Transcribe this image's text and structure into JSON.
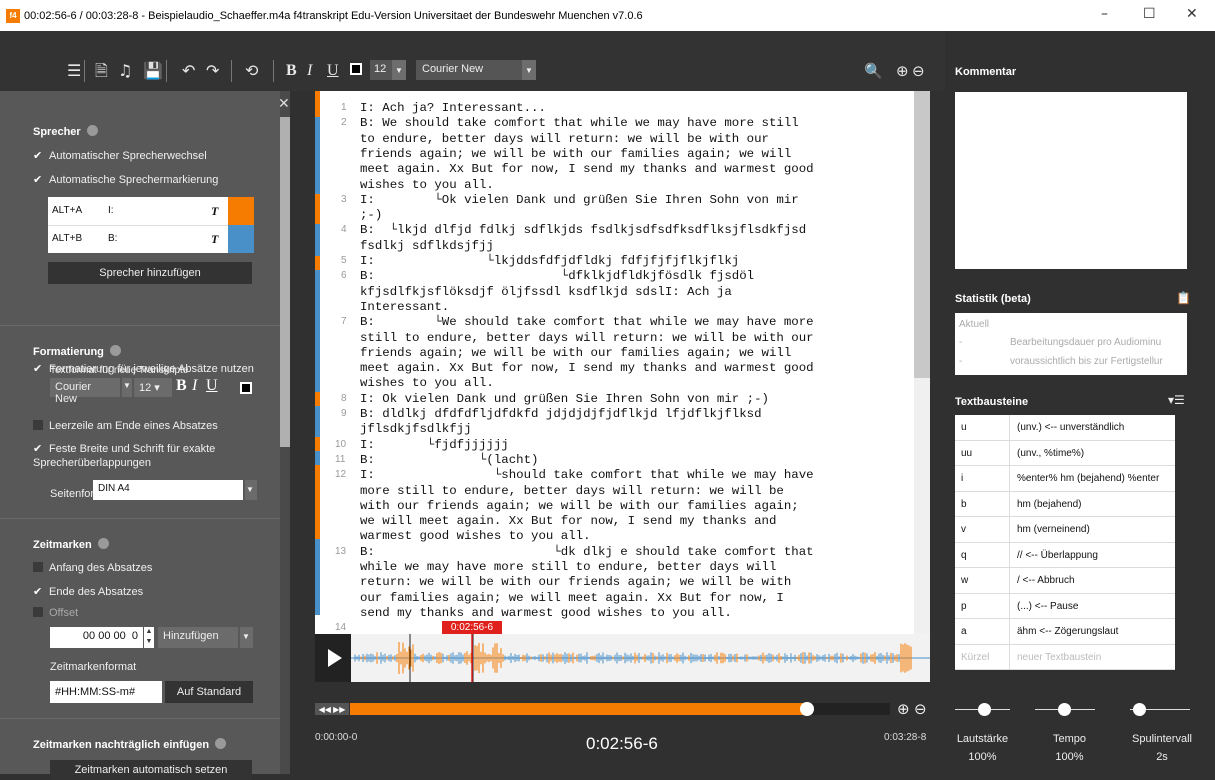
{
  "window": {
    "title": "00:02:56-6 / 00:03:28-8 - Beispielaudio_Schaeffer.m4a f4transkript Edu-Version Universitaet der Bundeswehr Muenchen v7.0.6",
    "app_icon_text": "f4"
  },
  "toolbar": {
    "font_size": "12",
    "font_name": "Courier New",
    "bold": "B",
    "italic": "I",
    "underline": "U"
  },
  "left_panel": {
    "sprecher": {
      "title": "Sprecher",
      "auto_wechsel": "Automatischer Sprecherwechsel",
      "auto_markierung": "Automatische Sprechermarkierung",
      "speakers": [
        {
          "shortcut": "ALT+A",
          "label": "I:",
          "style": "T",
          "color": "#f57c00"
        },
        {
          "shortcut": "ALT+B",
          "label": "B:",
          "style": "T",
          "color": "#4a90c8"
        }
      ],
      "add_button": "Sprecher hinzufügen",
      "absatz_format": "Formatierung für jeweilige Absätze nutzen"
    },
    "formatierung": {
      "title": "Formatierung",
      "textformat_label": "Textformat für neue Transkripte",
      "font": "Courier New",
      "size": "12",
      "bold": "B",
      "italic": "I",
      "underline": "U",
      "leerzeile": "Leerzeile am Ende eines Absatzes",
      "feste_breite": "Feste Breite und Schrift für exakte Sprecherüberlappungen",
      "seitenformat_label": "Seitenformat",
      "seitenformat_value": "DIN A4"
    },
    "zeitmarken": {
      "title": "Zeitmarken",
      "anfang": "Anfang des Absatzes",
      "ende": "Ende des Absatzes",
      "offset": "Offset",
      "offset_value": "00 00 00",
      "offset_frac": "0",
      "hinzufuegen": "Hinzufügen",
      "format_label": "Zeitmarkenformat",
      "format_value": "#HH:MM:SS-m#",
      "standard_button": "Auf Standard"
    },
    "nachtraeglich": {
      "title": "Zeitmarken nachträglich einfügen",
      "auto_button": "Zeitmarken automatisch setzen"
    }
  },
  "editor": {
    "lines": [
      {
        "num": "1",
        "text": "I: Ach ja? Interessant..."
      },
      {
        "num": "2",
        "text": "B: We should take comfort that while we may have more still"
      },
      {
        "num": "",
        "text": "to endure, better days will return: we will be with our"
      },
      {
        "num": "",
        "text": "friends again; we will be with our families again; we will"
      },
      {
        "num": "",
        "text": "meet again. Xx But for now, I send my thanks and warmest good"
      },
      {
        "num": "",
        "text": "wishes to you all."
      },
      {
        "num": "3",
        "text": "I:        └Ok vielen Dank und grüßen Sie Ihren Sohn von mir"
      },
      {
        "num": "",
        "text": ";-)"
      },
      {
        "num": "4",
        "text": "B:  └lkjd dlfjd fdlkj sdflkjds fsdlkjsdfsdfksdflksjflsdkfjsd"
      },
      {
        "num": "",
        "text": "fsdlkj sdflkdsjfjj"
      },
      {
        "num": "5",
        "text": "I:               └lkjddsfdfjdfldkj fdfjfjfjflkjflkj"
      },
      {
        "num": "6",
        "text": "B:                         └dfklkjdfldkjfösdlk fjsdöl"
      },
      {
        "num": "",
        "text": "kfjsdlfkjsflöksdjf öljfssdl ksdflkjd sdslI: Ach ja"
      },
      {
        "num": "",
        "text": "Interessant."
      },
      {
        "num": "7",
        "text": "B:        └We should take comfort that while we may have more"
      },
      {
        "num": "",
        "text": "still to endure, better days will return: we will be with our"
      },
      {
        "num": "",
        "text": "friends again; we will be with our families again; we will"
      },
      {
        "num": "",
        "text": "meet again. Xx But for now, I send my thanks and warmest good"
      },
      {
        "num": "",
        "text": "wishes to you all."
      },
      {
        "num": "8",
        "text": "I: Ok vielen Dank und grüßen Sie Ihren Sohn von mir ;-)"
      },
      {
        "num": "9",
        "text": "B: dldlkj dfdfdfljdfdkfd jdjdjdjfjdflkjd lfjdflkjflksd"
      },
      {
        "num": "",
        "text": "jflsdkjfsdlkfjj"
      },
      {
        "num": "10",
        "text": "I:       └fjdfjjjjjj"
      },
      {
        "num": "11",
        "text": "B:              └(lacht)"
      },
      {
        "num": "12",
        "text": "I:                └should take comfort that while we may have"
      },
      {
        "num": "",
        "text": "more still to endure, better days will return: we will be"
      },
      {
        "num": "",
        "text": "with our friends again; we will be with our families again;"
      },
      {
        "num": "",
        "text": "we will meet again. Xx But for now, I send my thanks and"
      },
      {
        "num": "",
        "text": "warmest good wishes to you all."
      },
      {
        "num": "13",
        "text": "B:                        └dk dlkj e should take comfort that"
      },
      {
        "num": "",
        "text": "while we may have more still to endure, better days will"
      },
      {
        "num": "",
        "text": "return: we will be with our friends again; we will be with"
      },
      {
        "num": "",
        "text": "our families again; we will meet again. Xx But for now, I"
      },
      {
        "num": "",
        "text": "send my thanks and warmest good wishes to you all."
      },
      {
        "num": "14",
        "text": ""
      }
    ]
  },
  "player": {
    "current_marker": "0:02:56-6",
    "start_time": "0:00:00-0",
    "current_time": "0:02:56-6",
    "end_time": "0:03:28-8",
    "progress": 0.848
  },
  "right_panel": {
    "comment_title": "Kommentar",
    "stats_title": "Statistik (beta)",
    "stats_lines": [
      {
        "left": "Aktuell",
        "right": ""
      },
      {
        "left": "-",
        "right": "Bearbeitungsdauer pro Audiominu"
      },
      {
        "left": "-",
        "right": "voraussichtlich bis zur Fertigstellur"
      }
    ],
    "snippets_title": "Textbausteine",
    "snippets": [
      {
        "key": "u",
        "value": "(unv.) <-- unverständlich"
      },
      {
        "key": "uu",
        "value": "(unv., %time%)"
      },
      {
        "key": "i",
        "value": "%enter% hm (bejahend) %enter"
      },
      {
        "key": "b",
        "value": "hm (bejahend)"
      },
      {
        "key": "v",
        "value": "hm (verneinend)"
      },
      {
        "key": "q",
        "value": "// <-- Überlappung"
      },
      {
        "key": "w",
        "value": "/ <-- Abbruch"
      },
      {
        "key": "p",
        "value": "(...) <-- Pause"
      },
      {
        "key": "a",
        "value": "ähm <-- Zögerungslaut"
      },
      {
        "key": "Kürzel",
        "value": "neuer Textbaustein"
      }
    ],
    "sliders": [
      {
        "label": "Lautstärke",
        "value": "100%",
        "level": 0.5
      },
      {
        "label": "Tempo",
        "value": "100%",
        "level": 0.5
      },
      {
        "label": "Spulintervall",
        "value": "2s",
        "level": 0.1
      }
    ]
  },
  "colors": {
    "accent": "#f57c00",
    "speaker_b": "#4a90c8",
    "marker": "#e0201b"
  }
}
